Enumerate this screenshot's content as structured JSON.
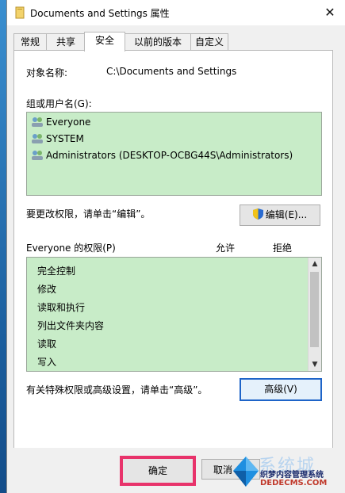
{
  "window": {
    "title": "Documents and Settings 属性",
    "close_glyph": "✕"
  },
  "tabs": [
    {
      "label": "常规"
    },
    {
      "label": "共享"
    },
    {
      "label": "安全",
      "active": true
    },
    {
      "label": "以前的版本"
    },
    {
      "label": "自定义"
    }
  ],
  "object": {
    "label": "对象名称:",
    "value": "C:\\Documents and Settings"
  },
  "groups": {
    "label": "组或用户名(G):",
    "users": [
      "Everyone",
      "SYSTEM",
      "Administrators (DESKTOP-OCBG44S\\Administrators)"
    ]
  },
  "change_hint": "要更改权限，请单击“编辑”。",
  "edit_button": "编辑(E)...",
  "permissions": {
    "label": "Everyone 的权限(P)",
    "allow_header": "允许",
    "deny_header": "拒绝",
    "items": [
      "完全控制",
      "修改",
      "读取和执行",
      "列出文件夹内容",
      "读取",
      "写入"
    ]
  },
  "advanced_hint": "有关特殊权限或高级设置，请单击“高级”。",
  "advanced_button": "高级(V)",
  "footer": {
    "ok": "确定",
    "cancel": "取消"
  },
  "watermark": {
    "brand": "系统城",
    "line1": "织梦内容管理系统",
    "line2": "DEDECMS.COM"
  },
  "colors": {
    "list_bg": "#c8ecc8",
    "highlight": "#e8336b",
    "focus_border": "#1e64c8"
  }
}
